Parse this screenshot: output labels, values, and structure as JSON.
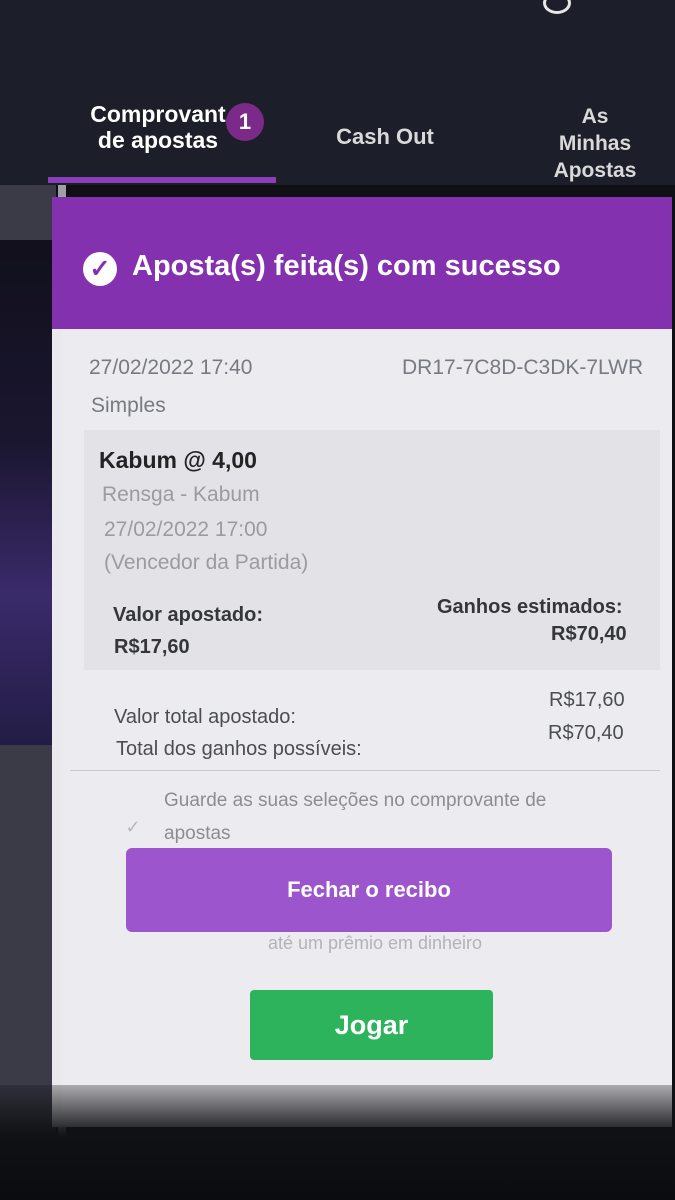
{
  "tabs": {
    "betslip_line1": "Comprovant",
    "betslip_line2": "de apostas",
    "betslip_count": "1",
    "cashout": "Cash Out",
    "mybets_line1": "As",
    "mybets_line2": "Minhas",
    "mybets_line3": "Apostas"
  },
  "banner": {
    "message": "Aposta(s) feita(s) com sucesso",
    "color": "#8431b0"
  },
  "receipt": {
    "datetime": "27/02/2022 17:40",
    "reference": "DR17-7C8D-C3DK-7LWR",
    "bet_type": "Simples",
    "selection": {
      "pick_odds": "Kabum @ 4,00",
      "event": "Rensga - Kabum",
      "event_datetime": "27/02/2022 17:00",
      "market": "(Vencedor da Partida)"
    },
    "stake_label": "Valor apostado:",
    "stake_value": "R$17,60",
    "est_win_label": "Ganhos estimados:",
    "est_win_value": "R$70,40",
    "total_stake_label": "Valor total apostado:",
    "total_stake_value": "R$17,60",
    "total_win_label": "Total dos ganhos possíveis:",
    "total_win_value": "R$70,40",
    "keep_selections_text": "Guarde as suas seleções no comprovante de apostas",
    "close_button": "Fechar o recibo"
  },
  "promo": {
    "text": "até um prêmio em dinheiro",
    "play_button": "Jogar",
    "play_color": "#2db35c"
  }
}
